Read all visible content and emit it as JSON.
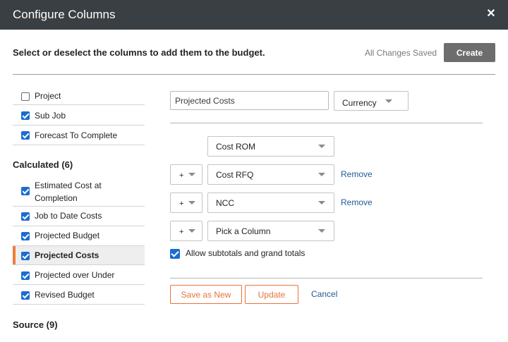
{
  "dialog": {
    "title": "Configure Columns",
    "close_icon": "close-icon",
    "subheader": "Select or deselect the columns to add them to the budget.",
    "status": "All Changes Saved",
    "create_label": "Create"
  },
  "left": {
    "top_items": [
      {
        "label": "Project",
        "checked": false
      },
      {
        "label": "Sub Job",
        "checked": true
      },
      {
        "label": "Forecast To Complete",
        "checked": true
      }
    ],
    "calculated_title": "Calculated (6)",
    "calculated_items": [
      {
        "label": "Estimated Cost at Completion",
        "checked": true
      },
      {
        "label": "Job to Date Costs",
        "checked": true
      },
      {
        "label": "Projected Budget",
        "checked": true
      },
      {
        "label": "Projected Costs",
        "checked": true,
        "selected": true
      },
      {
        "label": "Projected over Under",
        "checked": true
      },
      {
        "label": "Revised Budget",
        "checked": true
      }
    ],
    "source_title": "Source (9)"
  },
  "right": {
    "name_value": "Projected Costs",
    "format_value": "Currency",
    "formula": [
      {
        "operator": "",
        "column": "Cost ROM",
        "remove": ""
      },
      {
        "operator": "+",
        "column": "Cost RFQ",
        "remove": "Remove"
      },
      {
        "operator": "+",
        "column": "NCC",
        "remove": "Remove"
      },
      {
        "operator": "+",
        "column": "Pick a Column",
        "remove": ""
      }
    ],
    "allow_label": "Allow subtotals and grand totals",
    "allow_checked": true,
    "save_as_new_label": "Save as New",
    "update_label": "Update",
    "cancel_label": "Cancel"
  },
  "colors": {
    "titlebar": "#3a3f43",
    "accent": "#e8743b",
    "checkbox": "#1a6dd0",
    "link": "#1e5a99"
  }
}
